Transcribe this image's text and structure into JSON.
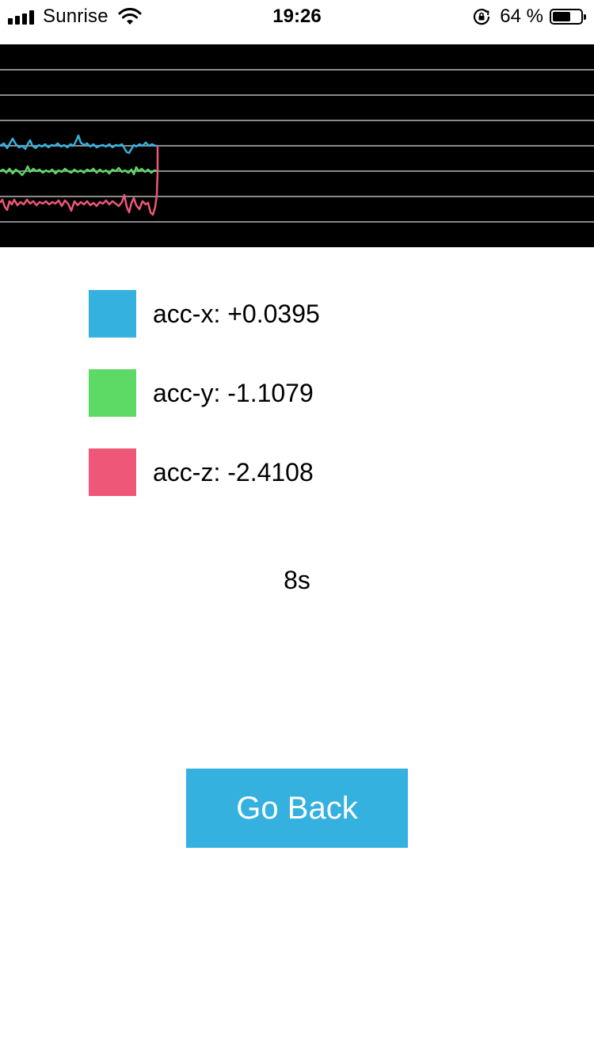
{
  "status_bar": {
    "carrier": "Sunrise",
    "time": "19:26",
    "battery_percent_label": "64 %",
    "battery_level": 0.64,
    "signal_icon": "cellular-signal-icon",
    "wifi_icon": "wifi-icon",
    "rotation_lock_icon": "rotation-lock-icon",
    "battery_icon": "battery-icon"
  },
  "chart": {
    "background": "#000000",
    "gridline_color": "#8a8a8a",
    "series_colors": {
      "x": "#35b1e0",
      "y": "#5dd966",
      "z": "#ee5778"
    }
  },
  "legend": [
    {
      "id": "x",
      "label": "acc-x: +0.0395",
      "color": "#35b1e0"
    },
    {
      "id": "y",
      "label": "acc-y: -1.1079",
      "color": "#5dd966"
    },
    {
      "id": "z",
      "label": "acc-z: -2.4108",
      "color": "#ee5778"
    }
  ],
  "timer": "8s",
  "go_back": {
    "label": "Go Back",
    "color": "#35b1e0"
  }
}
